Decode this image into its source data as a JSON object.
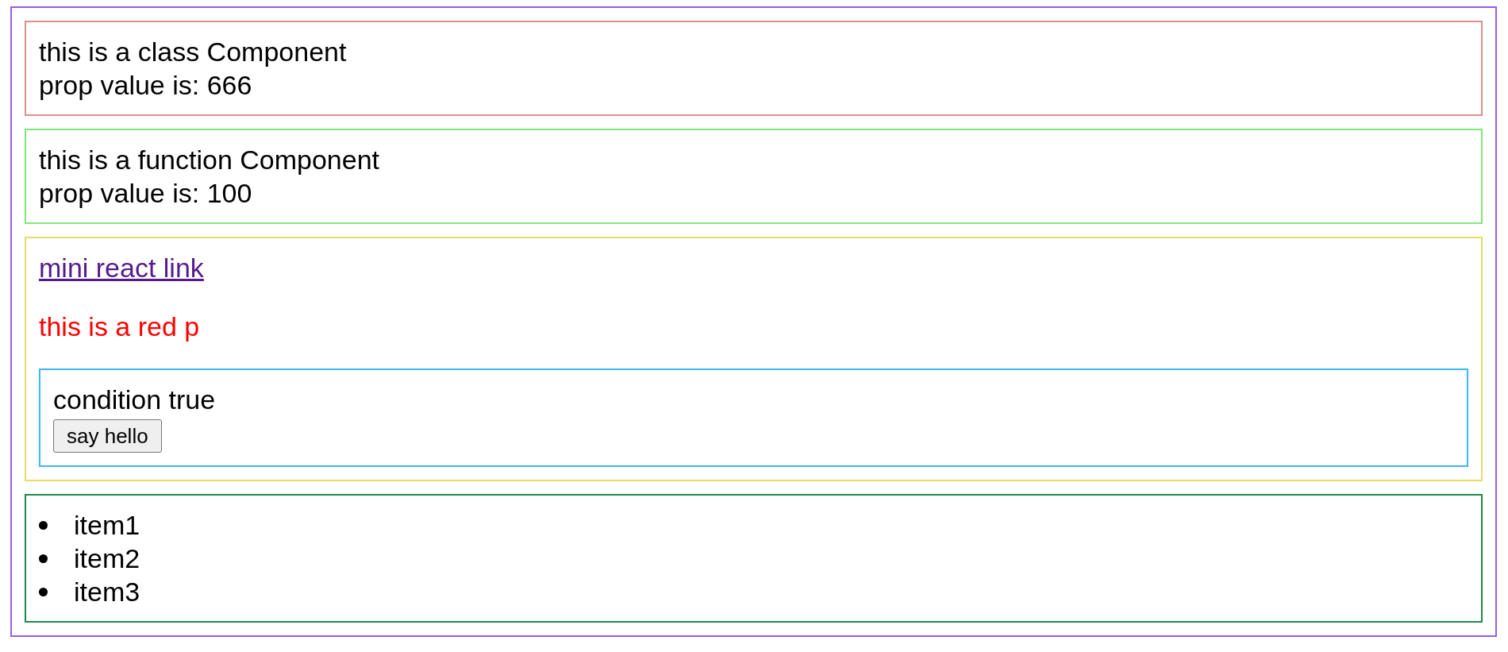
{
  "panels": [
    {
      "kind": "box",
      "color": "#df8e8e",
      "children": [
        {
          "kind": "text",
          "text": "this is a class Component"
        },
        {
          "kind": "text",
          "text": "prop value is: 666"
        }
      ]
    },
    {
      "kind": "box",
      "color": "#80e878",
      "children": [
        {
          "kind": "text",
          "text": "this is a function Component"
        },
        {
          "kind": "text",
          "text": "prop value is: 100"
        }
      ]
    },
    {
      "kind": "box",
      "color": "#e6dc64",
      "children": [
        {
          "kind": "link",
          "text": "mini react link",
          "visited": true
        },
        {
          "kind": "paragraph",
          "text": "this is a red p",
          "color": "#ff0000"
        },
        {
          "kind": "box",
          "color": "#3bb8ef",
          "children": [
            {
              "kind": "text",
              "text": "condition true"
            },
            {
              "kind": "button",
              "label": "say hello"
            }
          ]
        }
      ]
    },
    {
      "kind": "list",
      "color": "#1b8a4c",
      "items": [
        "item1",
        "item2",
        "item3"
      ]
    }
  ]
}
